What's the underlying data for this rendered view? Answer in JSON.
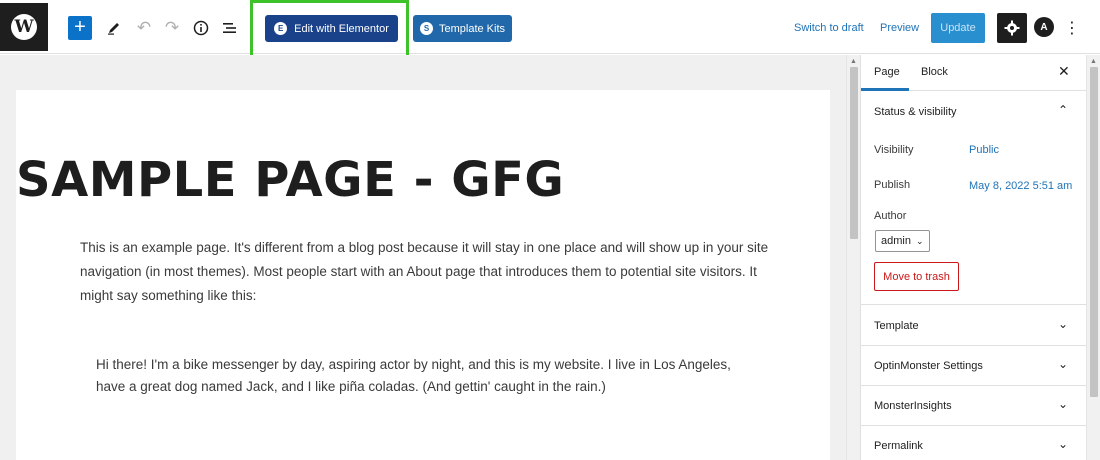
{
  "toolbar": {
    "wp_logo": "W",
    "add_label": "+",
    "edit_elementor_label": "Edit with Elementor",
    "elementor_badge": "E",
    "template_kits_label": "Template Kits",
    "template_kits_badge": "S",
    "switch_to_draft_label": "Switch to draft",
    "preview_label": "Preview",
    "update_label": "Update",
    "astra_badge": "A"
  },
  "icons": {
    "add": "plus-icon",
    "tools": "pencil-icon",
    "undo": "undo-icon",
    "redo": "redo-icon",
    "details": "info-icon",
    "list_view": "list-view-icon",
    "settings": "gear-icon",
    "more": "more-vertical-icon"
  },
  "colors": {
    "highlight": "#3ec22a",
    "elementor_button": "#19428a",
    "kits_button": "#2068a9",
    "update_button": "#2a8fcf",
    "link": "#1f73b7",
    "trash": "#cc1818"
  },
  "editor": {
    "page_title": "SAMPLE PAGE - GFG",
    "paragraph": "This is an example page. It's different from a blog post because it will stay in one place and will show up in your site navigation (in most themes). Most people start with an About page that introduces them to potential site visitors. It might say something like this:",
    "quote": "Hi there! I'm a bike messenger by day, aspiring actor by night, and this is my website. I live in Los Angeles, have a great dog named Jack, and I like piña coladas. (And gettin' caught in the rain.)"
  },
  "sidebar": {
    "tab_page": "Page",
    "tab_block": "Block",
    "status_visibility": {
      "title": "Status & visibility",
      "visibility_label": "Visibility",
      "visibility_value": "Public",
      "publish_label": "Publish",
      "publish_value": "May 8, 2022 5:51 am",
      "author_label": "Author",
      "author_value": "admin",
      "trash_label": "Move to trash"
    },
    "panels": [
      "Template",
      "OptinMonster Settings",
      "MonsterInsights",
      "Permalink"
    ]
  }
}
